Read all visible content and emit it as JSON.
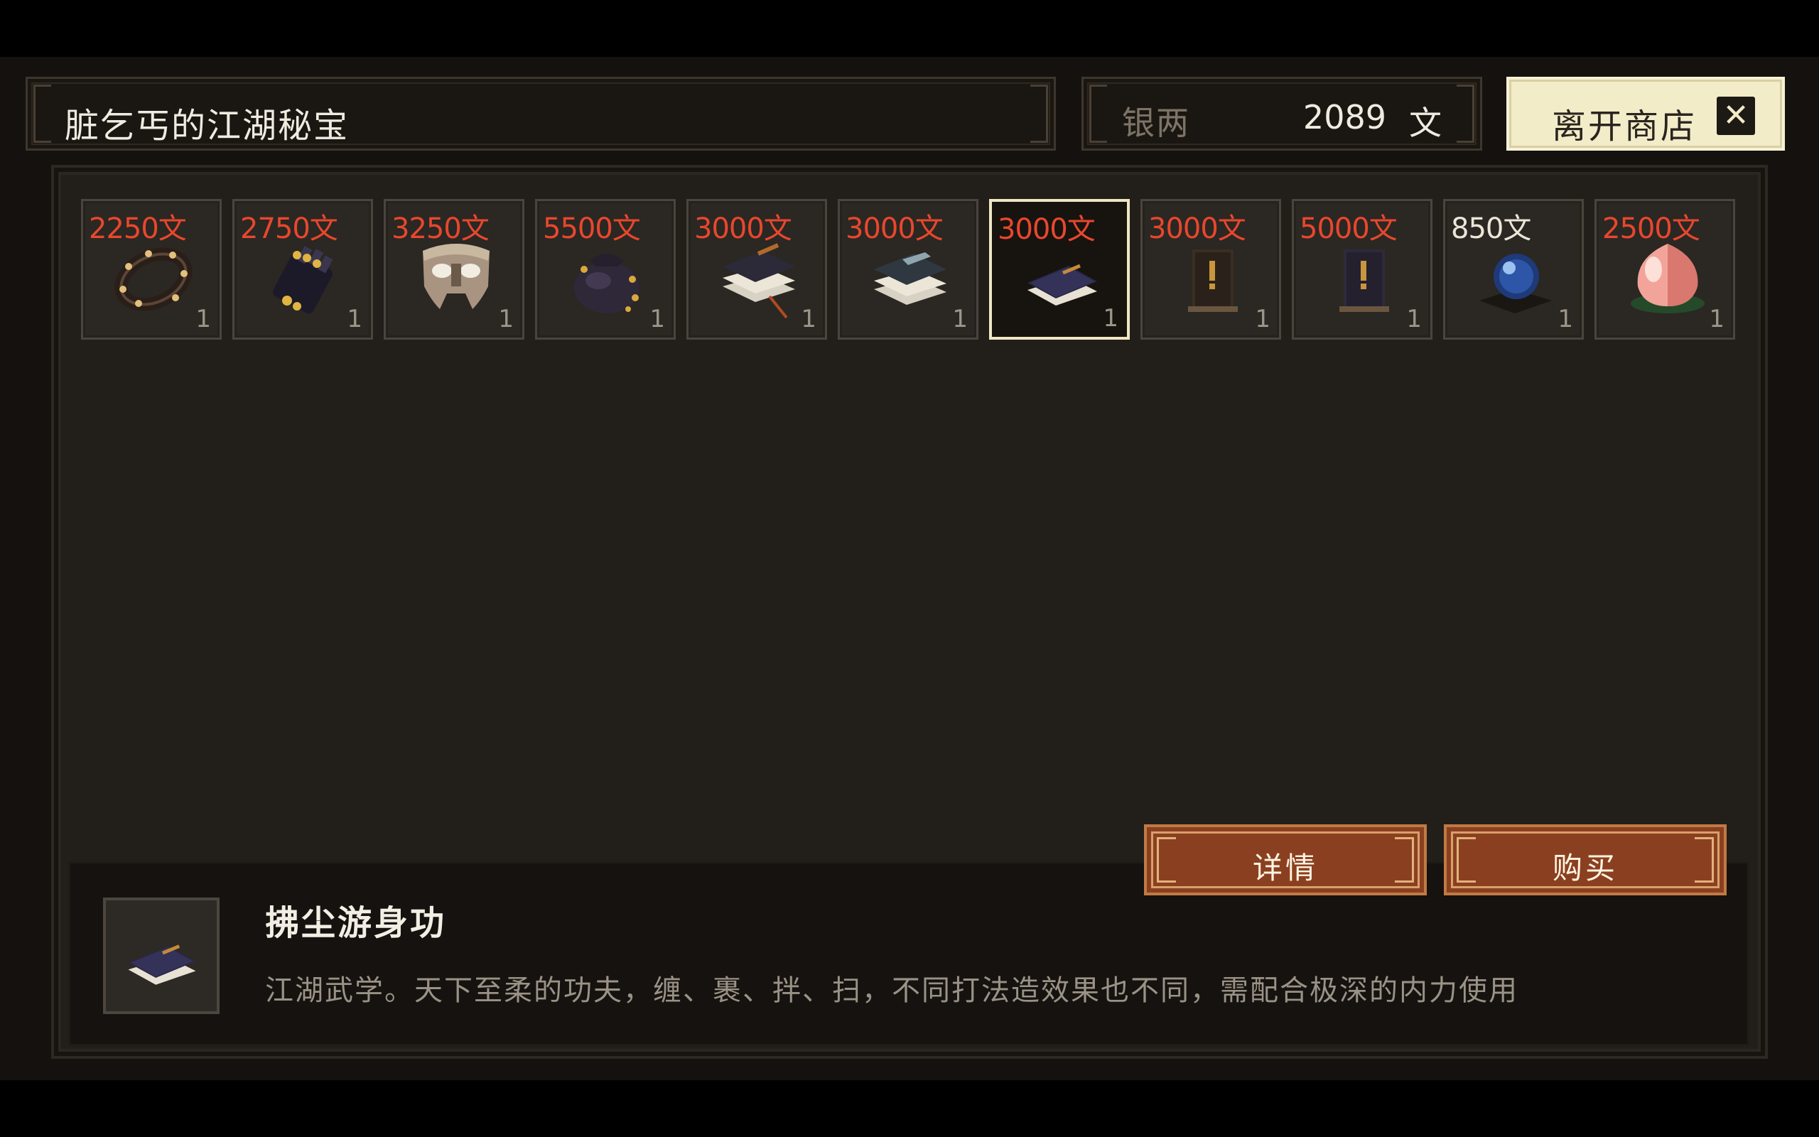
{
  "shop": {
    "title": "脏乞丐的江湖秘宝",
    "money_label": "银两",
    "money_value": "2089",
    "money_unit": "文",
    "leave_label": "离开商店"
  },
  "items": [
    {
      "price": "2250文",
      "qty": "1",
      "icon": "spiked-ring-icon",
      "affordable": false
    },
    {
      "price": "2750文",
      "qty": "1",
      "icon": "gauntlet-icon",
      "affordable": false
    },
    {
      "price": "3250文",
      "qty": "1",
      "icon": "mask-icon",
      "affordable": false
    },
    {
      "price": "5500文",
      "qty": "1",
      "icon": "pouch-icon",
      "affordable": false
    },
    {
      "price": "3000文",
      "qty": "1",
      "icon": "book-stack-icon",
      "affordable": false
    },
    {
      "price": "3000文",
      "qty": "1",
      "icon": "book-stack-icon",
      "affordable": false
    },
    {
      "price": "3000文",
      "qty": "1",
      "icon": "book-icon",
      "affordable": false,
      "selected": true
    },
    {
      "price": "3000文",
      "qty": "1",
      "icon": "scroll-book-icon",
      "affordable": false
    },
    {
      "price": "5000文",
      "qty": "1",
      "icon": "scroll-book-icon",
      "affordable": false
    },
    {
      "price": "850文",
      "qty": "1",
      "icon": "crystal-orb-icon",
      "affordable": true
    },
    {
      "price": "2500文",
      "qty": "1",
      "icon": "peach-icon",
      "affordable": false
    }
  ],
  "buttons": {
    "details": "详情",
    "buy": "购买"
  },
  "selected_item": {
    "name": "拂尘游身功",
    "description": "江湖武学。天下至柔的功夫，缠、裹、拌、扫，不同打法造效果也不同，需配合极深的内力使用",
    "icon": "book-icon"
  },
  "colors": {
    "price_expensive": "#e8472e",
    "price_affordable": "#ece6d8",
    "button_fill": "#8a4020",
    "leave_button": "#f3ecc8"
  }
}
